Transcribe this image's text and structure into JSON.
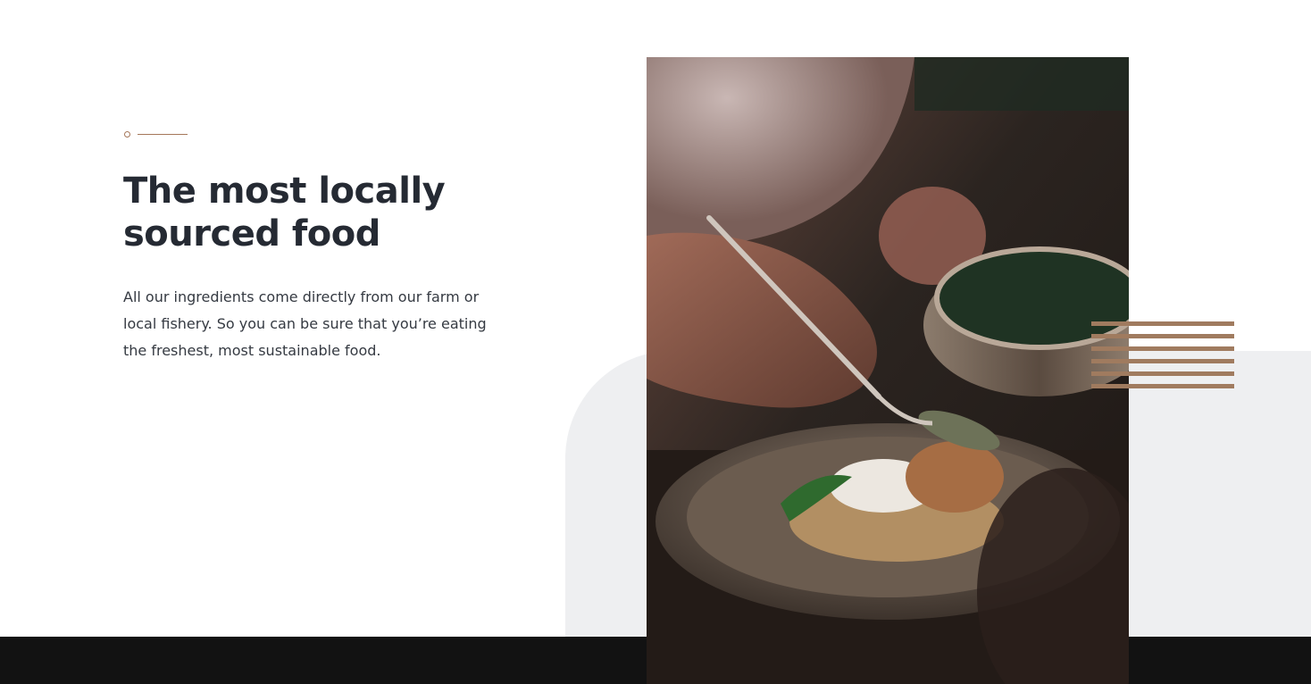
{
  "section": {
    "heading": "The most locally sourced food",
    "body": "All our ingredients come directly from our farm or local fishery. So you can be sure that you’re eating the freshest, most sustainable food."
  },
  "image": {
    "subject": "chef plating food"
  },
  "colors": {
    "accent": "#a5775a",
    "stripes": "#a07b5f",
    "heading": "#252a33",
    "panel": "#eeeff1",
    "footer": "#121212"
  }
}
